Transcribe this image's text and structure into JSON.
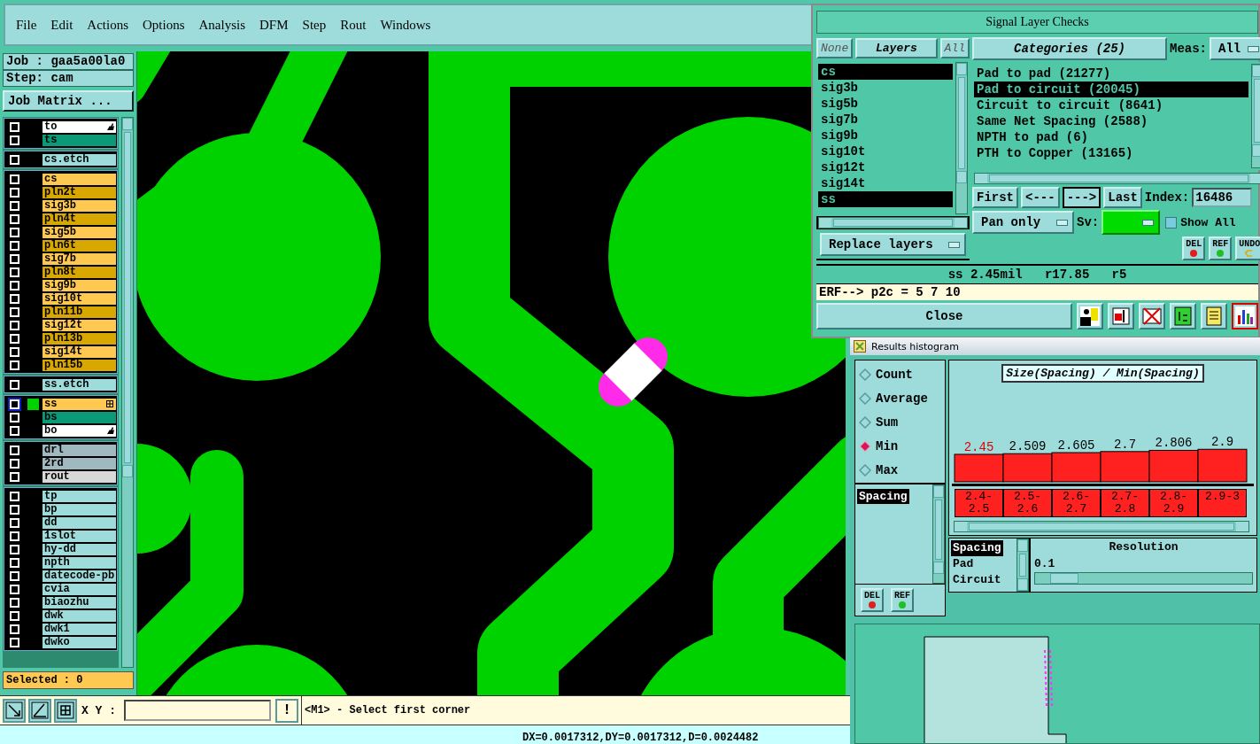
{
  "menu_bar": {
    "items": [
      "File",
      "Edit",
      "Actions",
      "Options",
      "Analysis",
      "DFM",
      "Step",
      "Rout",
      "Windows"
    ]
  },
  "job_panel": {
    "job": "Job : gaa5a00la0",
    "step": "Step: cam",
    "matrix_button": "Job Matrix ..."
  },
  "layer_groups": [
    {
      "layers": [
        {
          "name": "to",
          "color": "#ffffff",
          "selected": false,
          "checked": false,
          "kind": "hand"
        },
        {
          "name": "ts",
          "color": "#0a9a78",
          "selected": false,
          "checked": false,
          "kind": "plain"
        }
      ]
    },
    {
      "layers": [
        {
          "name": "cs.etch",
          "color": "#9edcdc",
          "selected": false,
          "checked": false,
          "kind": "plain"
        }
      ]
    },
    {
      "layers": [
        {
          "name": "cs",
          "color": "#ffc850",
          "selected": false,
          "checked": false,
          "kind": "plain"
        },
        {
          "name": "pln2t",
          "color": "#d8a800",
          "selected": false,
          "checked": false,
          "kind": "plain"
        },
        {
          "name": "sig3b",
          "color": "#ffc850",
          "selected": false,
          "checked": false,
          "kind": "plain"
        },
        {
          "name": "pln4t",
          "color": "#d8a800",
          "selected": false,
          "checked": false,
          "kind": "plain"
        },
        {
          "name": "sig5b",
          "color": "#ffc850",
          "selected": false,
          "checked": false,
          "kind": "plain"
        },
        {
          "name": "pln6t",
          "color": "#d8a800",
          "selected": false,
          "checked": false,
          "kind": "plain"
        },
        {
          "name": "sig7b",
          "color": "#ffc850",
          "selected": false,
          "checked": false,
          "kind": "plain"
        },
        {
          "name": "pln8t",
          "color": "#d8a800",
          "selected": false,
          "checked": false,
          "kind": "plain"
        },
        {
          "name": "sig9b",
          "color": "#ffc850",
          "selected": false,
          "checked": false,
          "kind": "plain"
        },
        {
          "name": "sig10t",
          "color": "#ffc850",
          "selected": false,
          "checked": false,
          "kind": "plain"
        },
        {
          "name": "pln11b",
          "color": "#d8a800",
          "selected": false,
          "checked": false,
          "kind": "plain"
        },
        {
          "name": "sig12t",
          "color": "#ffc850",
          "selected": false,
          "checked": false,
          "kind": "plain"
        },
        {
          "name": "pln13b",
          "color": "#d8a800",
          "selected": false,
          "checked": false,
          "kind": "plain"
        },
        {
          "name": "sig14t",
          "color": "#ffc850",
          "selected": false,
          "checked": false,
          "kind": "plain"
        },
        {
          "name": "pln15b",
          "color": "#d8a800",
          "selected": false,
          "checked": false,
          "kind": "plain"
        }
      ]
    },
    {
      "layers": [
        {
          "name": "ss.etch",
          "color": "#9edcdc",
          "selected": false,
          "checked": false,
          "kind": "plain"
        }
      ]
    },
    {
      "layers": [
        {
          "name": "ss",
          "color": "#ffc850",
          "selected": true,
          "checked": false,
          "kind": "grid"
        },
        {
          "name": "bs",
          "color": "#0a9a78",
          "selected": false,
          "checked": false,
          "kind": "plain"
        },
        {
          "name": "bo",
          "color": "#ffffff",
          "selected": false,
          "checked": false,
          "kind": "hand"
        }
      ]
    },
    {
      "layers": [
        {
          "name": "drl",
          "color": "#a0b8c0",
          "selected": false,
          "checked": false,
          "kind": "plain"
        },
        {
          "name": "2rd",
          "color": "#a0b8c0",
          "selected": false,
          "checked": false,
          "kind": "plain"
        },
        {
          "name": "rout",
          "color": "#d8d8d8",
          "selected": false,
          "checked": false,
          "kind": "plain"
        }
      ]
    },
    {
      "layers": [
        {
          "name": "tp",
          "color": "#9edcdc",
          "selected": false,
          "checked": false,
          "kind": "plain"
        },
        {
          "name": "bp",
          "color": "#9edcdc",
          "selected": false,
          "checked": false,
          "kind": "plain"
        },
        {
          "name": "dd",
          "color": "#9edcdc",
          "selected": false,
          "checked": false,
          "kind": "plain"
        },
        {
          "name": "1slot",
          "color": "#9edcdc",
          "selected": false,
          "checked": false,
          "kind": "plain"
        },
        {
          "name": "hy-dd",
          "color": "#9edcdc",
          "selected": false,
          "checked": false,
          "kind": "plain"
        },
        {
          "name": "npth",
          "color": "#9edcdc",
          "selected": false,
          "checked": false,
          "kind": "plain"
        },
        {
          "name": "datecode-pb",
          "color": "#9edcdc",
          "selected": false,
          "checked": false,
          "kind": "plain"
        },
        {
          "name": "cvia",
          "color": "#9edcdc",
          "selected": false,
          "checked": false,
          "kind": "plain"
        },
        {
          "name": "biaozhu",
          "color": "#9edcdc",
          "selected": false,
          "checked": false,
          "kind": "plain"
        },
        {
          "name": "dwk",
          "color": "#9edcdc",
          "selected": false,
          "checked": false,
          "kind": "plain"
        },
        {
          "name": "dwk1",
          "color": "#9edcdc",
          "selected": false,
          "checked": false,
          "kind": "plain"
        },
        {
          "name": "dwko",
          "color": "#9edcdc",
          "selected": false,
          "checked": false,
          "kind": "plain"
        }
      ]
    }
  ],
  "selected_count": "Selected : 0",
  "toolbar": {
    "xy_label": "X Y :",
    "alert_button": "!",
    "prompt": "<M1> - Select first corner"
  },
  "status_bar": "DX=0.0017312,DY=0.0017312,D=0.0024482",
  "signal_checks": {
    "title": "Signal Layer Checks",
    "filter_buttons": [
      {
        "label": "None",
        "selected": false
      },
      {
        "label": "Layers",
        "selected": true
      },
      {
        "label": "All",
        "selected": false
      }
    ],
    "layers": [
      {
        "name": "cs",
        "selected": true
      },
      {
        "name": "sig3b",
        "selected": false
      },
      {
        "name": "sig5b",
        "selected": false
      },
      {
        "name": "sig7b",
        "selected": false
      },
      {
        "name": "sig9b",
        "selected": false
      },
      {
        "name": "sig10t",
        "selected": false
      },
      {
        "name": "sig12t",
        "selected": false
      },
      {
        "name": "sig14t",
        "selected": false
      },
      {
        "name": "ss",
        "selected": true
      }
    ],
    "replace_button": "Replace layers",
    "categories_button": "Categories (25)",
    "meas_label": "Meas:",
    "meas_value": "All",
    "categories": [
      {
        "label": "Pad to pad (21277)",
        "selected": false
      },
      {
        "label": "Pad to circuit (20045)",
        "selected": true
      },
      {
        "label": "Circuit to circuit (8641)",
        "selected": false
      },
      {
        "label": "Same Net Spacing (2588)",
        "selected": false
      },
      {
        "label": "NPTH to pad (6)",
        "selected": false
      },
      {
        "label": "PTH to Copper (13165)",
        "selected": false
      }
    ],
    "nav_buttons": [
      {
        "label": "First",
        "selected": false
      },
      {
        "label": "<---",
        "selected": false
      },
      {
        "label": "--->",
        "selected": true
      },
      {
        "label": "Last",
        "selected": false
      }
    ],
    "index_label": "Index:",
    "index_value": "16486",
    "pan_value": "Pan only",
    "sv_label": "Sv:",
    "show_all": {
      "label": "Show All",
      "checked": false
    },
    "action_buttons": [
      {
        "label": "DEL",
        "kind": "dot",
        "color": "#e02020"
      },
      {
        "label": "REF",
        "kind": "dot",
        "color": "#20c020"
      },
      {
        "label": "UNDO",
        "kind": "arrow"
      }
    ],
    "info": "ss 2.45mil   r17.85   r5",
    "erf": "ERF--> p2c = 5 7 10",
    "close_button": "Close"
  },
  "histogram": {
    "title": "Results histogram",
    "modes": [
      {
        "label": "Count",
        "selected": false
      },
      {
        "label": "Average",
        "selected": false
      },
      {
        "label": "Sum",
        "selected": false
      },
      {
        "label": "Min",
        "selected": true
      },
      {
        "label": "Max",
        "selected": false
      }
    ],
    "measures": [
      {
        "label": "Spacing",
        "selected": true
      }
    ],
    "buttons": [
      {
        "label": "DEL",
        "color": "#e02020"
      },
      {
        "label": "REF",
        "color": "#20c020"
      }
    ],
    "chart_title": "Size(Spacing) / Min(Spacing)",
    "chart_data": {
      "type": "bar",
      "categories": [
        "2.4-2.5",
        "2.5-2.6",
        "2.6-2.7",
        "2.7-2.8",
        "2.8-2.9",
        "2.9-3"
      ],
      "values": [
        2.45,
        2.509,
        2.605,
        2.7,
        2.806,
        2.9
      ],
      "data_labels": true
    },
    "groups": [
      {
        "label": "Spacing",
        "selected": true
      },
      {
        "label": "Pad",
        "selected": false
      },
      {
        "label": "Circuit",
        "selected": false
      }
    ],
    "resolution_label": "Resolution",
    "resolution_value": "0.1",
    "resolution_slider": {
      "level": 0.07
    }
  }
}
